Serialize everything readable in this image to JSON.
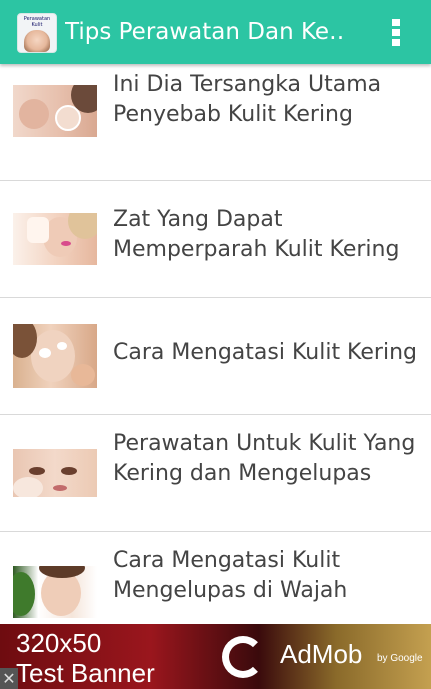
{
  "appbar": {
    "title": "Tips Perawatan Dan Ke…",
    "icon_caption": "Perawatan Kulit",
    "color": "#2cc5a3"
  },
  "items": [
    {
      "title": "Ini Dia Tersangka Utama Penyebab Kulit Kering"
    },
    {
      "title": "Zat Yang Dapat Memperparah Kulit Kering"
    },
    {
      "title": "Cara Mengatasi Kulit Kering"
    },
    {
      "title": "Perawatan Untuk Kulit Yang Kering dan Mengelupas"
    },
    {
      "title": "Cara Mengatasi Kulit Mengelupas di Wajah"
    }
  ],
  "ad": {
    "size_text": "320x50",
    "label": "Test Banner",
    "brand": "AdMob",
    "byline": "by Google",
    "close_glyph": "✕"
  }
}
